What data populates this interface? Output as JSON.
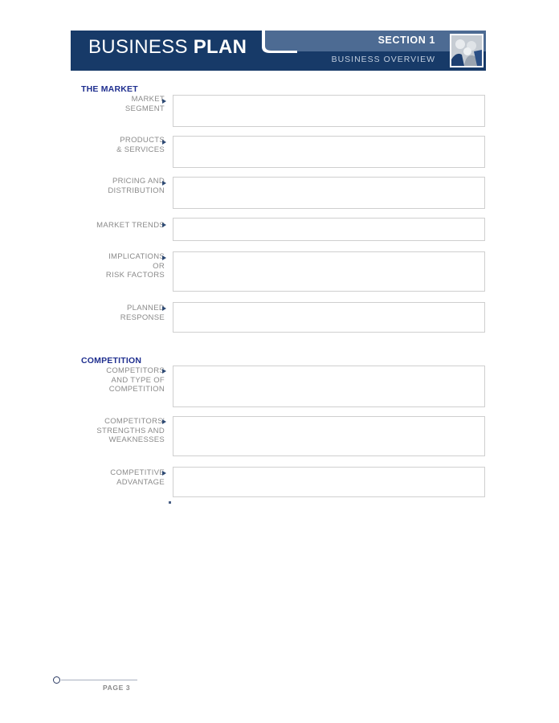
{
  "header": {
    "title_thin": "BUSINESS",
    "title_bold": "PLAN",
    "section": "SECTION 1",
    "subtitle": "BUSINESS OVERVIEW",
    "photo_icon": "business-people-photo-icon",
    "colors": {
      "dark_navy": "#173a68",
      "slate_blue": "#4d6b93",
      "white": "#ffffff",
      "subtitle_text": "#c3cfdf"
    }
  },
  "groups": [
    {
      "heading": "THE MARKET",
      "fields": [
        {
          "label_lines": [
            "MARKET",
            "SEGMENT"
          ],
          "value": "",
          "marker": "triangle-right-icon"
        },
        {
          "label_lines": [
            "PRODUCTS",
            "& SERVICES"
          ],
          "value": "",
          "marker": "triangle-right-icon"
        },
        {
          "label_lines": [
            "PRICING AND",
            "DISTRIBUTION"
          ],
          "value": "",
          "marker": "triangle-right-icon"
        },
        {
          "label_lines": [
            "MARKET TRENDS"
          ],
          "value": "",
          "marker": "triangle-right-icon"
        },
        {
          "label_lines": [
            "IMPLICATIONS",
            "OR",
            "RISK FACTORS"
          ],
          "value": "",
          "marker": "triangle-right-icon"
        },
        {
          "label_lines": [
            "PLANNED",
            "RESPONSE"
          ],
          "value": "",
          "marker": "triangle-right-icon"
        }
      ]
    },
    {
      "heading": "COMPETITION",
      "fields": [
        {
          "label_lines": [
            "COMPETITORS",
            "AND TYPE OF",
            "COMPETITION"
          ],
          "value": "",
          "marker": "triangle-right-icon"
        },
        {
          "label_lines": [
            "COMPETITORS'",
            "STRENGTHS AND",
            "WEAKNESSES"
          ],
          "value": "",
          "marker": "triangle-right-icon"
        },
        {
          "label_lines": [
            "COMPETITIVE",
            "ADVANTAGE"
          ],
          "value": "",
          "marker": "triangle-right-icon"
        }
      ]
    }
  ],
  "footer": {
    "page_label": "PAGE 3"
  },
  "theme": {
    "heading_color": "#1f2f8f",
    "label_color": "#8a8a8a",
    "box_border": "#cfcfcf",
    "marker_color": "#2e4a74"
  }
}
